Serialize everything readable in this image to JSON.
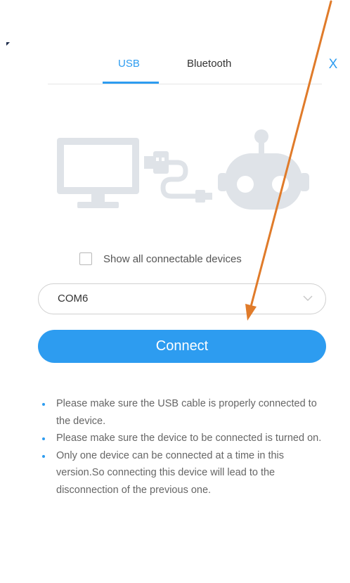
{
  "tabs": [
    {
      "label": "USB",
      "active": true
    },
    {
      "label": "Bluetooth",
      "active": false
    }
  ],
  "close_label": "X",
  "checkbox": {
    "label": "Show all connectable devices",
    "checked": false
  },
  "port_select": {
    "value": "COM6"
  },
  "connect_button": {
    "label": "Connect"
  },
  "notes": [
    "Please make sure the USB cable is properly connected to the device.",
    "Please make sure the device to be connected is turned on.",
    "Only one device can be connected at a time in this version.So connecting this device will lead to the disconnection of the previous one."
  ],
  "colors": {
    "accent": "#2d9cf0",
    "illustration": "#dfe3e8",
    "annotation_arrow": "#e07b2a"
  },
  "icons": [
    "computer-monitor-icon",
    "usb-cable-icon",
    "robot-icon",
    "close-icon",
    "chevron-down-icon",
    "checkbox-icon"
  ]
}
